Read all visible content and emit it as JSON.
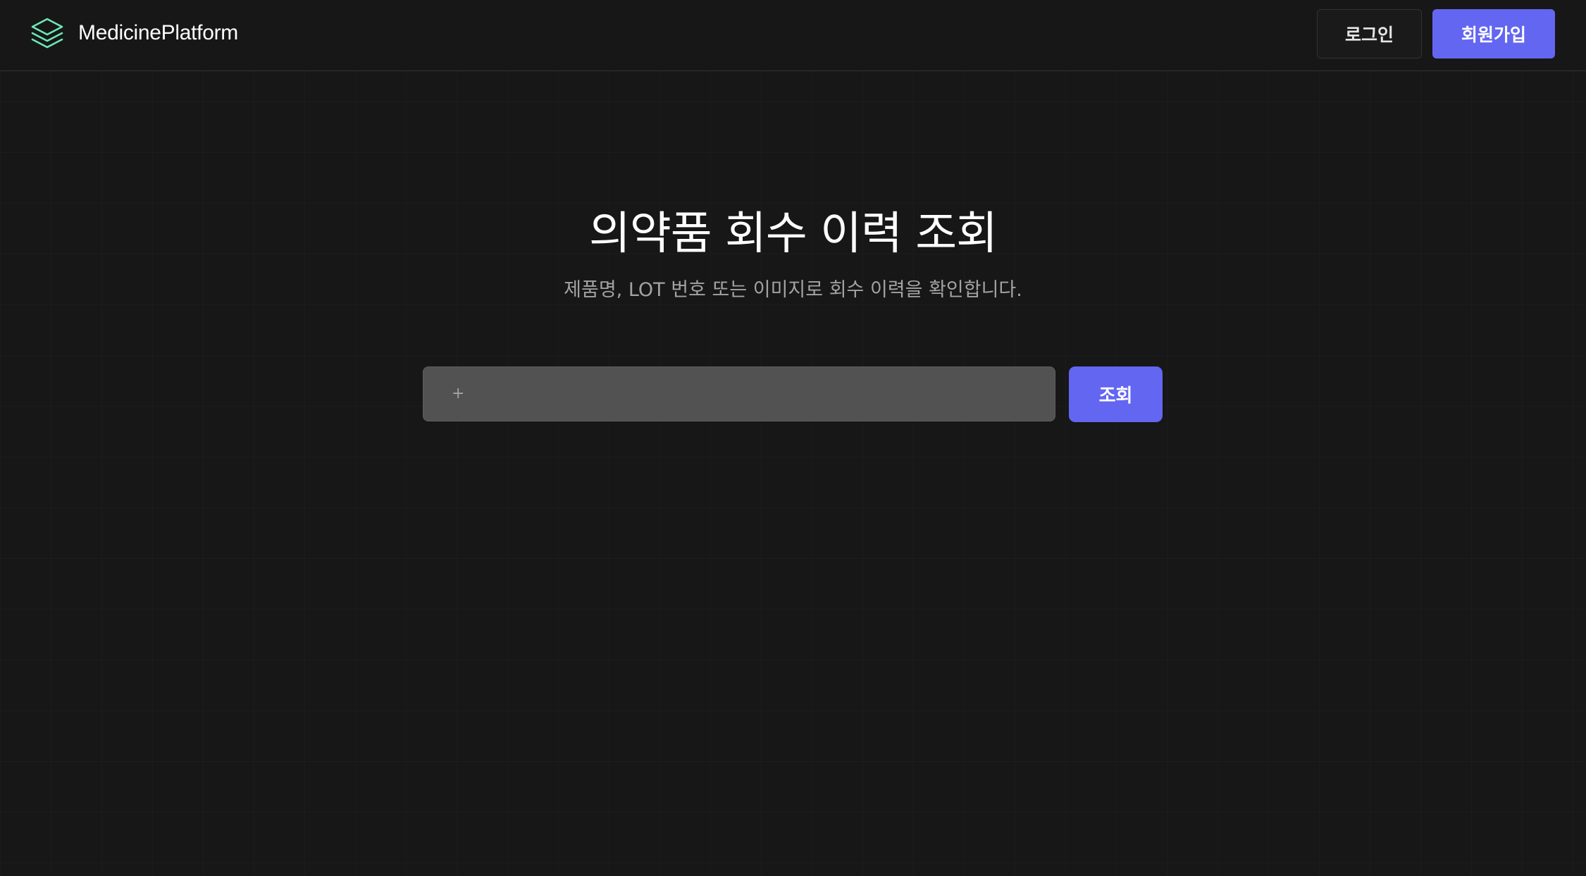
{
  "header": {
    "brand_name": "MedicinePlatform",
    "brand_icon": "layers-icon",
    "login_label": "로그인",
    "signup_label": "회원가입"
  },
  "main": {
    "title": "의약품 회수 이력 조회",
    "subtitle": "제품명, LOT 번호 또는 이미지로 회수 이력을 확인합니다.",
    "search": {
      "prefix_icon": "plus-icon",
      "prefix_glyph": "+",
      "value": "",
      "placeholder": "",
      "button_label": "조회"
    }
  },
  "colors": {
    "background": "#171717",
    "accent": "#6366f1",
    "brand_icon": "#6ee7b7",
    "input_bg": "#525252",
    "muted_text": "#a3a3a3"
  }
}
